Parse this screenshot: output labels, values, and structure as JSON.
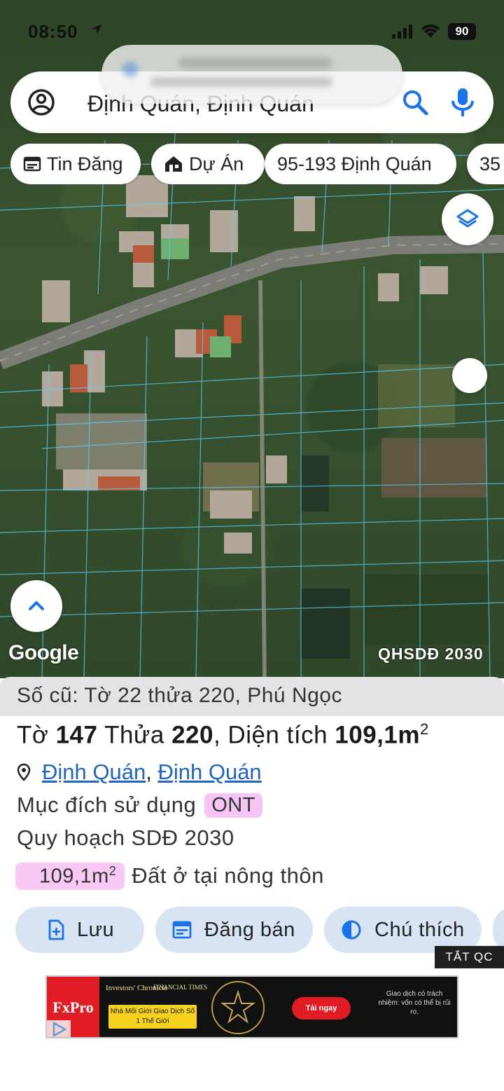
{
  "status_bar": {
    "time": "08:50",
    "battery": "90"
  },
  "search": {
    "query": "Định Quán, Định Quán"
  },
  "chips": [
    {
      "label": "Tin Đăng",
      "icon": "calendar-icon"
    },
    {
      "label": "Dự Án",
      "icon": "house-icon"
    },
    {
      "label": "95-193 Định Quán",
      "icon": ""
    },
    {
      "label": "35",
      "icon": ""
    }
  ],
  "map": {
    "attribution": "Google",
    "plan_layer": "QHSDĐ 2030"
  },
  "parcel": {
    "old_info": "Số cũ: Tờ 22 thửa 220, Phú Ngọc",
    "sheet_label": "Tờ",
    "sheet_number": "147",
    "lot_label": "Thửa",
    "lot_number": "220",
    "area_label": ", Diện tích",
    "area_value": "109,1m",
    "area_sup": "2",
    "location_1": "Định Quán",
    "location_sep": ",",
    "location_2": "Định Quán",
    "purpose_label": "Mục đích sử dụng",
    "purpose_code": "ONT",
    "plan_label": "Quy hoạch SDĐ 2030",
    "plan_area_value": "109,1m",
    "plan_area_sup": "2",
    "plan_area_desc": "Đất ở tại nông thôn"
  },
  "actions": [
    {
      "label": "Lưu",
      "icon": "add-file-icon"
    },
    {
      "label": "Đăng bán",
      "icon": "calendar-icon"
    },
    {
      "label": "Chú thích",
      "icon": "contrast-icon"
    }
  ],
  "hide_ads": "TẮT QC",
  "ad": {
    "brand": "FxPro",
    "publisher": "Investors' Chronicle",
    "ft": "FINANCIAL TIMES",
    "headline": "Nhà Môi Giới Giao Dịch Số 1 Thế Giới",
    "cta": "Tải ngay",
    "risk": "Giao dịch có trách nhiệm: vốn có thể bị rủi ro."
  },
  "colors": {
    "link": "#2266bb",
    "badge_pink": "#f5c6f5",
    "action_bg": "#d8e4f4",
    "ad_red": "#e21c24"
  }
}
